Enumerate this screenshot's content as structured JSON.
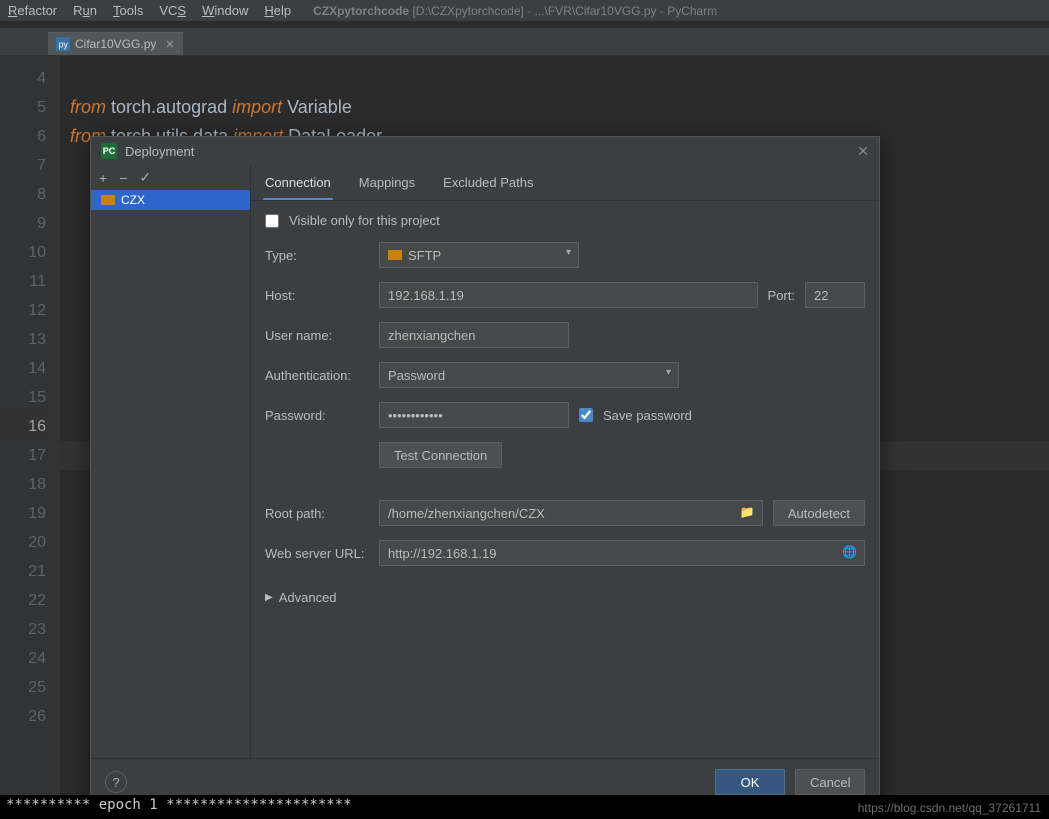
{
  "menubar": {
    "items": [
      {
        "label": "Refactor",
        "mn": "R"
      },
      {
        "label": "Run",
        "mn": "u"
      },
      {
        "label": "Tools",
        "mn": "T"
      },
      {
        "label": "VCS",
        "mn": "S"
      },
      {
        "label": "Window",
        "mn": "W"
      },
      {
        "label": "Help",
        "mn": "H"
      }
    ],
    "title_project": "CZXpytorchcode",
    "title_path": "[D:\\CZXpytorchcode] - ...\\FVR\\Cifar10VGG.py - PyCharm"
  },
  "tabs": {
    "file": "Cifar10VGG.py"
  },
  "editor": {
    "gutter": [
      "4",
      "5",
      "6",
      "7",
      "8",
      "9",
      "10",
      "11",
      "12",
      "13",
      "14",
      "15",
      "16",
      "17",
      "18",
      "19",
      "20",
      "21",
      "22",
      "23",
      "24",
      "25",
      "26"
    ],
    "line4_pre": "from ",
    "line4_mid": "torch.autograd ",
    "line4_imp": "import ",
    "line4_end": "Variable",
    "line5_pre": "from ",
    "line5_mid": "torch.utils.data ",
    "line5_imp": "import ",
    "line5_end": "DataLoader",
    "highlight_line_index": 12
  },
  "dialog": {
    "title": "Deployment",
    "app_icon": "PC",
    "toolbar": {
      "add": "+",
      "remove": "−",
      "check": "✓"
    },
    "servers": [
      {
        "name": "CZX"
      }
    ],
    "tabs": {
      "connection": "Connection",
      "mappings": "Mappings",
      "excluded": "Excluded Paths"
    },
    "form": {
      "visible_label": "Visible only for this project",
      "type_label": "Type:",
      "type_value": "SFTP",
      "host_label": "Host:",
      "host_value": "192.168.1.19",
      "port_label": "Port:",
      "port_value": "22",
      "user_label": "User name:",
      "user_value": "zhenxiangchen",
      "auth_label": "Authentication:",
      "auth_value": "Password",
      "pass_label": "Password:",
      "pass_value": "••••••••••••",
      "save_pass_label": "Save password",
      "test_label": "Test Connection",
      "root_label": "Root path:",
      "root_value": "/home/zhenxiangchen/CZX",
      "autodetect_label": "Autodetect",
      "weburl_label": "Web server URL:",
      "weburl_value": "http://192.168.1.19",
      "advanced_label": "Advanced"
    },
    "footer": {
      "ok": "OK",
      "cancel": "Cancel",
      "help": "?"
    }
  },
  "console": {
    "text": "**********  epoch 1  **********************"
  },
  "watermark": "https://blog.csdn.net/qq_37261711"
}
